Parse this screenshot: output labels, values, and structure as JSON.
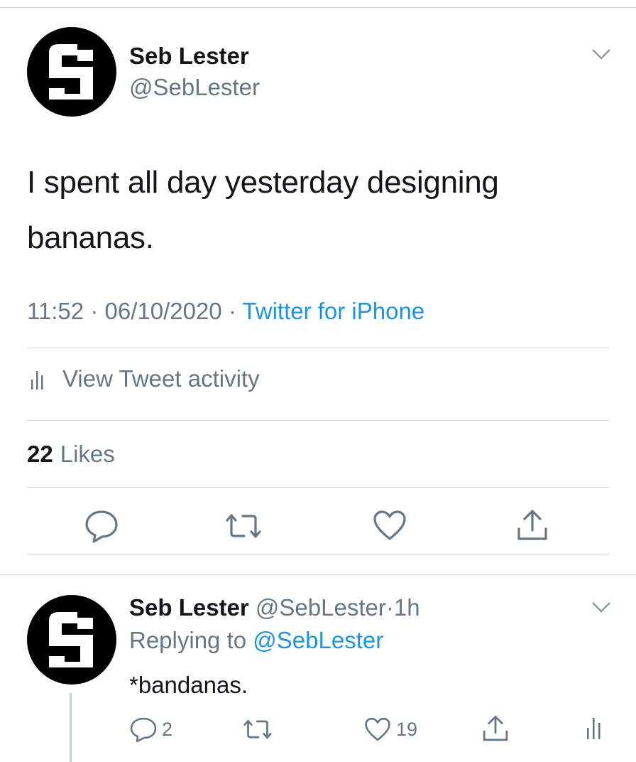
{
  "tweet": {
    "author": {
      "display_name": "Seb Lester",
      "handle": "@SebLester"
    },
    "text": "I spent all day yesterday designing bananas.",
    "time": "11:52",
    "date": "06/10/2020",
    "separator": "·",
    "source": "Twitter for iPhone",
    "activity_label": "View Tweet activity",
    "likes": {
      "count": "22",
      "label": "Likes"
    },
    "actions": {
      "reply_icon": "comment-icon",
      "retweet_icon": "retweet-icon",
      "like_icon": "heart-icon",
      "share_icon": "share-icon"
    }
  },
  "reply": {
    "author": {
      "display_name": "Seb Lester",
      "handle": "@SebLester"
    },
    "separator": "·",
    "time_ago": "1h",
    "replying_to_label": "Replying to",
    "replying_to_handle": "@SebLester",
    "text": "*bandanas.",
    "stats": {
      "replies": "2",
      "likes": "19"
    }
  },
  "colors": {
    "text_primary": "#14171a",
    "text_secondary": "#657786",
    "link": "#1b95e0",
    "divider": "#d4d9de",
    "avatar_bg": "#000000"
  }
}
